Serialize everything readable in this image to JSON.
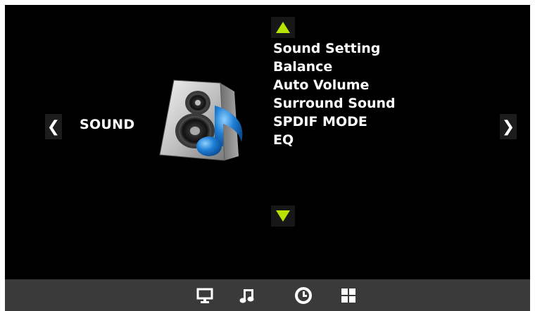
{
  "menu": {
    "title": "SOUND",
    "icon": "speaker-music-note-icon",
    "prev_glyph": "❮",
    "next_glyph": "❯"
  },
  "options": [
    "Sound Setting",
    "Balance",
    "Auto Volume",
    "Surround Sound",
    "SPDIF MODE",
    "EQ"
  ],
  "scroll": {
    "up_icon": "triangle-up-icon",
    "down_icon": "triangle-down-icon"
  },
  "dock": {
    "icons": [
      "monitor-icon",
      "music-note-icon",
      "clock-icon",
      "grid-icon"
    ]
  },
  "colors": {
    "panel_bg": "#000000",
    "bar_bg": "#3a3a3a",
    "accent_green": "#b8e300",
    "speaker_blue": "#1e7fd6",
    "text": "#ffffff"
  }
}
